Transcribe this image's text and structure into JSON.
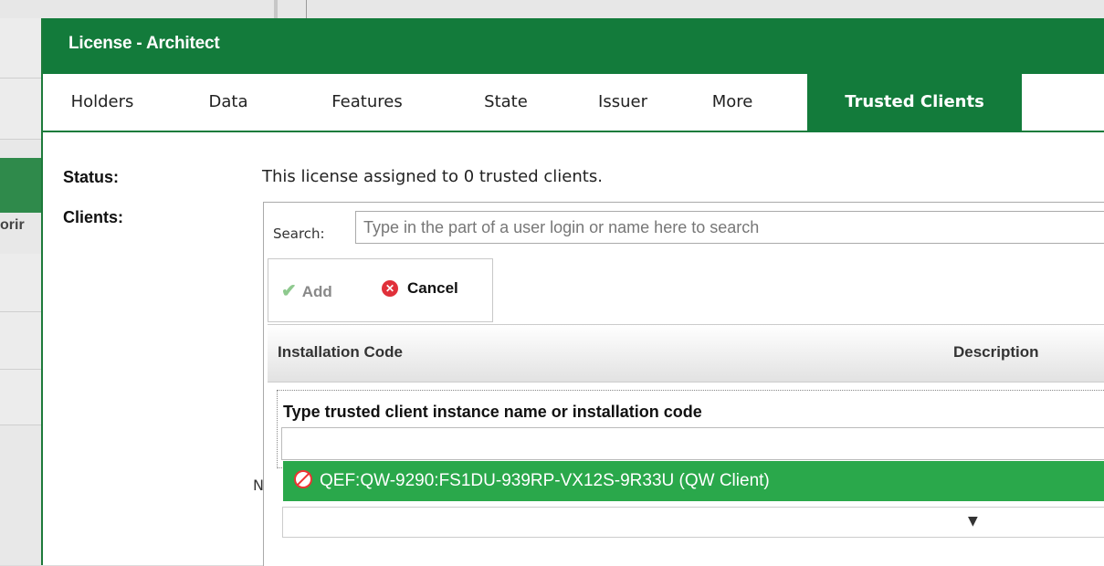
{
  "background": {
    "partial_text": "orir"
  },
  "dialog": {
    "title": "License - Architect",
    "tabs": [
      {
        "label": "Holders",
        "active": false
      },
      {
        "label": "Data",
        "active": false
      },
      {
        "label": "Features",
        "active": false
      },
      {
        "label": "State",
        "active": false
      },
      {
        "label": "Issuer",
        "active": false
      },
      {
        "label": "More",
        "active": false
      },
      {
        "label": "Trusted Clients",
        "active": true
      }
    ],
    "status_label": "Status:",
    "status_text": "This license assigned to 0 trusted clients.",
    "clients_label": "Clients:"
  },
  "clients": {
    "search_label": "Search:",
    "search_placeholder": "Type in the part of a user login or name here to search",
    "toolbar": {
      "add_label": "Add",
      "cancel_label": "Cancel"
    },
    "columns": [
      "Installation Code",
      "Description"
    ],
    "edit_prompt": "Type trusted client instance name or installation code",
    "dropdown_item": "QEF:QW-9290:FS1DU-939RP-VX12S-9R33U (QW Client)",
    "partial_text": "N"
  },
  "colors": {
    "primary_green": "#137b3b",
    "highlight_green": "#2aa84b",
    "cancel_red": "#e0303a"
  }
}
